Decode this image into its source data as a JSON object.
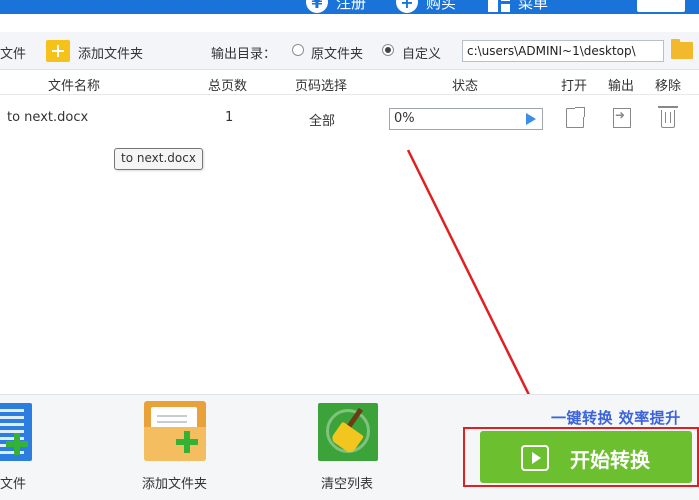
{
  "topbar": {
    "register_label": "注册",
    "buy_label": "购买",
    "menu_label": "菜单"
  },
  "toolbar": {
    "add_file_label": "文件",
    "add_folder_label": "添加文件夹",
    "output_dir_label": "输出目录：",
    "option_original": "原文件夹",
    "option_custom": "自定义",
    "output_path": "c:\\users\\ADMINI~1\\desktop\\"
  },
  "table": {
    "headers": {
      "name": "文件名称",
      "pages": "总页数",
      "page_select": "页码选择",
      "status": "状态",
      "open": "打开",
      "output": "输出",
      "remove": "移除"
    },
    "rows": [
      {
        "name": "to next.docx",
        "pages": "1",
        "page_select": "全部",
        "progress": "0%"
      }
    ]
  },
  "tooltip": "to next.docx",
  "bottom": {
    "add_file_label": "文件",
    "add_folder_label": "添加文件夹",
    "clear_list_label": "清空列表",
    "slogan": "一键转换  效率提升",
    "start_label": "开始转换"
  },
  "colors": {
    "brand_blue": "#1a73d9",
    "start_green": "#6cbf2e",
    "annotation_red": "#e02020",
    "slogan_blue": "#3c63d9"
  }
}
